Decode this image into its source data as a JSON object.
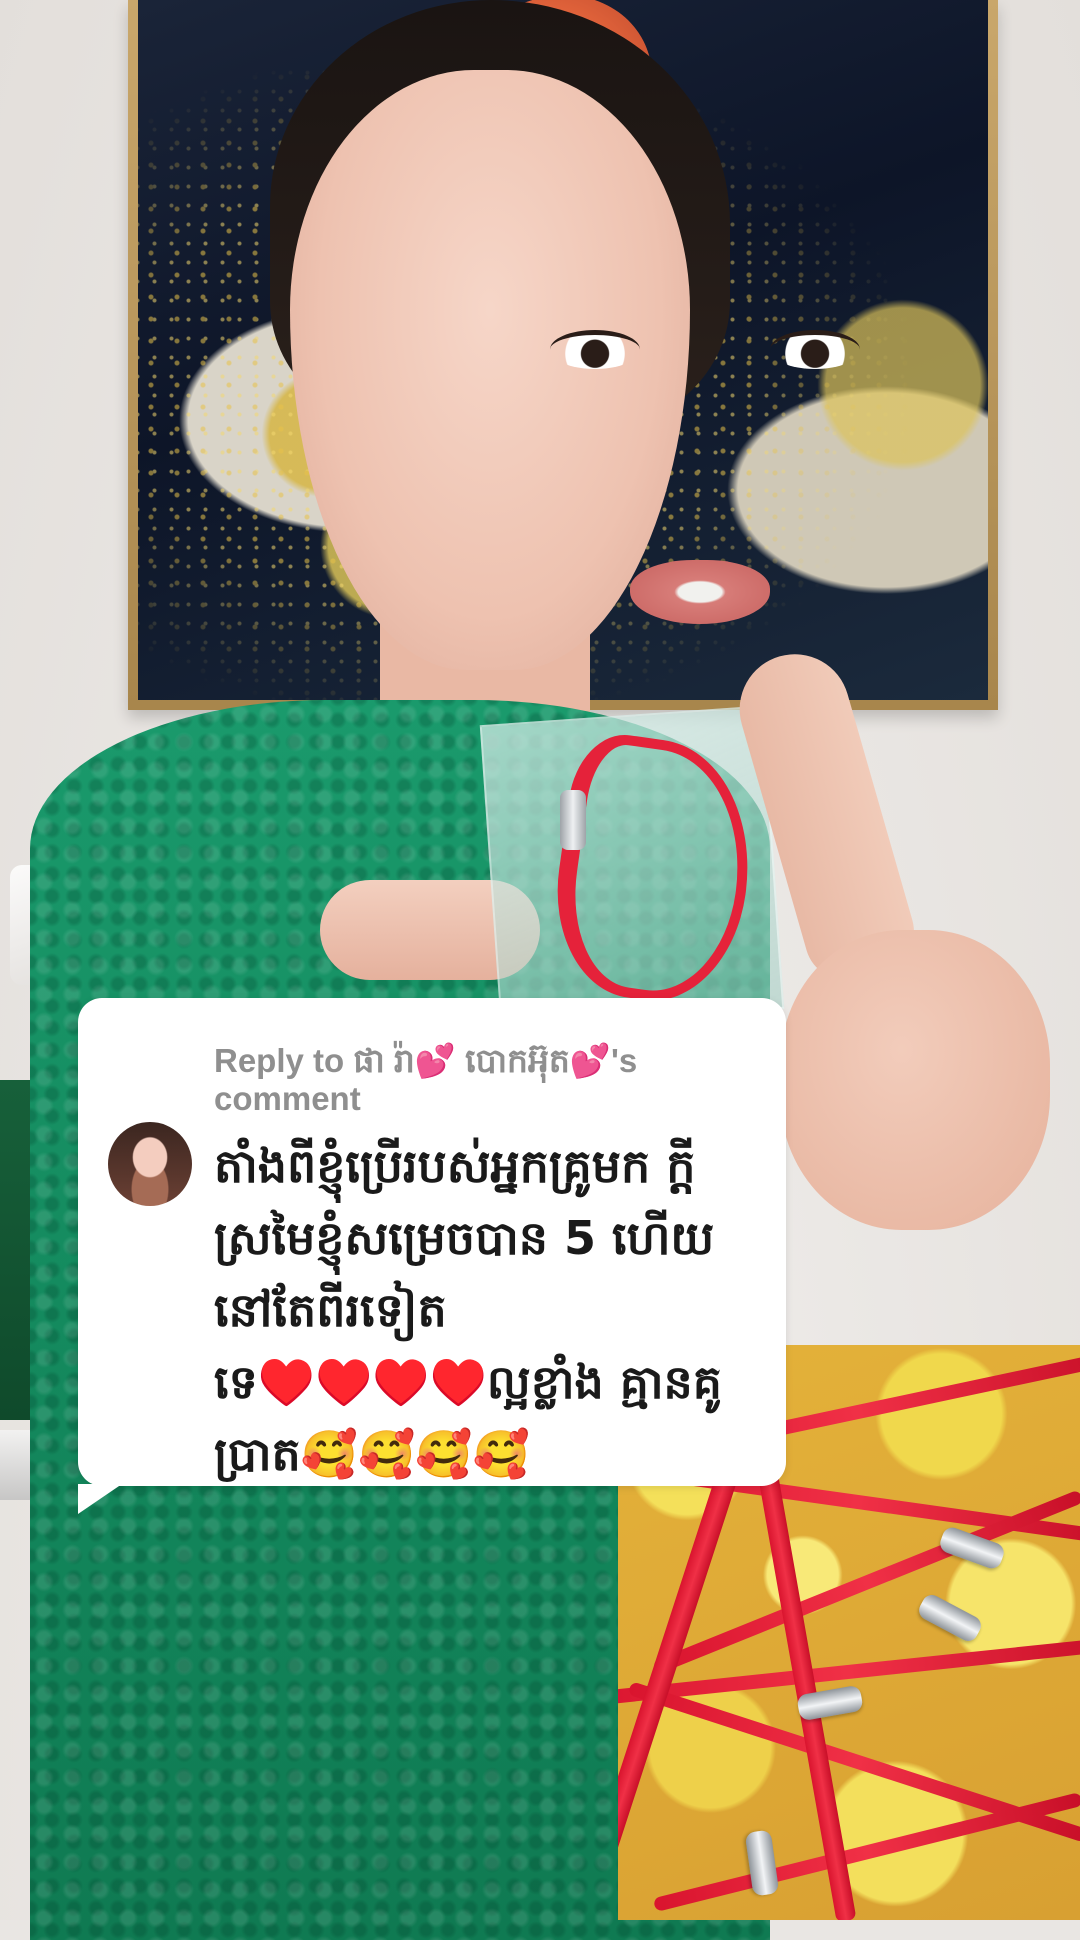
{
  "reply_card": {
    "header": "Reply to ផា រ៉ា💕 បោកអ៊ុត💕's comment",
    "comment_text": "តាំងពីខ្ញុំប្រើរបស់អ្នកគ្រូមក ក្តីស្រមៃខ្ញុំសម្រេចបាន 5 ហើយនៅតែពីរទៀត ទេ♥️♥️♥️♥️ល្អខ្លាំង គ្មានគូប្រាត🥰🥰🥰🥰",
    "avatar": "commenter-avatar"
  },
  "colors": {
    "bubble_background": "#ffffff",
    "header_text": "#8f8f8f",
    "comment_text": "#1a1a1a",
    "dress_green": "#148a5e",
    "thread_red": "#e5223a"
  },
  "icons": {
    "reply_tail": "speech-bubble-tail"
  }
}
